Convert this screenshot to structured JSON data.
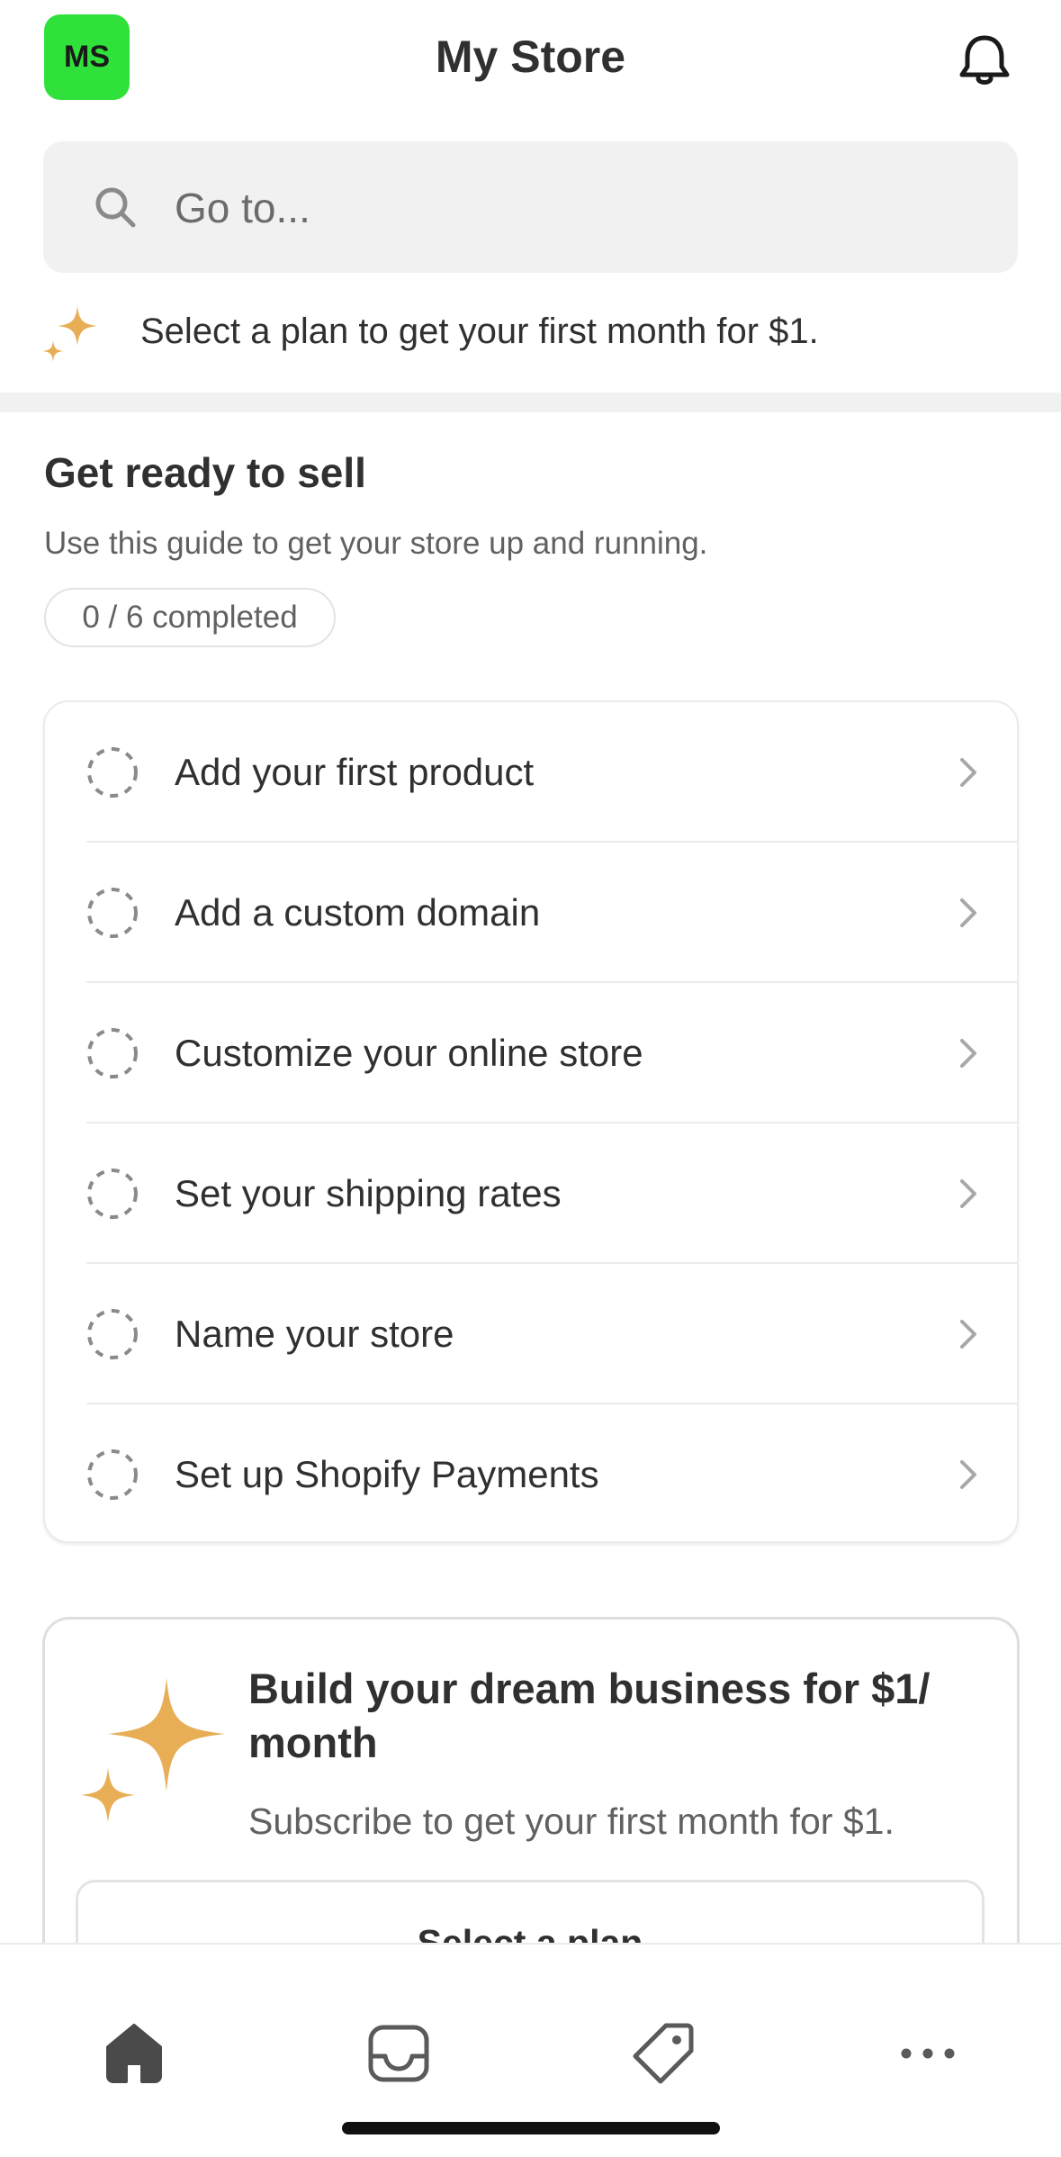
{
  "header": {
    "avatar_initials": "MS",
    "avatar_color": "#2fe13a",
    "title": "My Store",
    "notification_icon": "bell-icon"
  },
  "search": {
    "placeholder": "Go to...",
    "icon": "search-icon"
  },
  "promo_banner": {
    "icon": "sparkle-icon",
    "text": "Select a plan to get your first month for $1."
  },
  "setup_guide": {
    "title": "Get ready to sell",
    "subtitle": "Use this guide to get your store up and running.",
    "progress": "0 / 6 completed",
    "tasks": [
      {
        "label": "Add your first product"
      },
      {
        "label": "Add a custom domain"
      },
      {
        "label": "Customize your online store"
      },
      {
        "label": "Set your shipping rates"
      },
      {
        "label": "Name your store"
      },
      {
        "label": "Set up Shopify Payments"
      }
    ]
  },
  "upsell": {
    "icon": "sparkle-icon",
    "title": "Build your dream business for $1/ month",
    "subtitle": "Subscribe to get your first month for $1.",
    "button_label": "Select a plan",
    "accent_color": "#e8ae56"
  },
  "bottom_nav": {
    "items": [
      {
        "icon": "home-icon",
        "active": true
      },
      {
        "icon": "inbox-icon",
        "active": false
      },
      {
        "icon": "tag-icon",
        "active": false
      },
      {
        "icon": "more-icon",
        "active": false
      }
    ]
  }
}
